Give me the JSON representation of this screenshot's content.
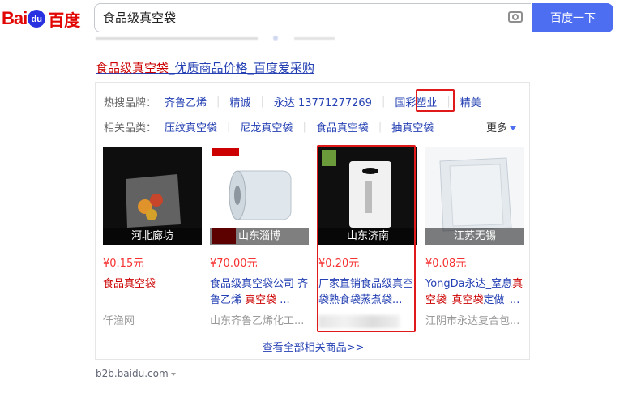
{
  "header": {
    "logo_text": "Bai",
    "logo_paw": "du",
    "logo_cn": "百度",
    "search_value": "食品级真空袋",
    "search_button": "百度一下",
    "icons": {
      "camera": "camera-icon"
    }
  },
  "result": {
    "title_kw": "食品级真空袋",
    "title_rest": "_优质商品价格_百度爱采购"
  },
  "brands": {
    "label": "热搜品牌：",
    "items": [
      "齐鲁乙烯",
      "精诚",
      "永达 13771277269",
      "国彩塑业",
      "精美"
    ]
  },
  "categories": {
    "label": "相关品类：",
    "items": [
      "压纹真空袋",
      "尼龙真空袋",
      "食品真空袋",
      "抽真空袋"
    ],
    "more": "更多"
  },
  "products": [
    {
      "location": "河北廊坊",
      "price": "¥0.15元",
      "name_kw": "食品真空袋",
      "name_rest": "",
      "seller": "仟渔网"
    },
    {
      "location": "山东淄博",
      "price": "¥70.00元",
      "name_pre": "食品级真空袋公司 齐鲁乙烯 ",
      "name_kw": "真空袋",
      "name_rest": " ...",
      "seller": "山东齐鲁乙烯化工..."
    },
    {
      "location": "山东济南",
      "price": "¥0.20元",
      "name_pre": "厂家直销食品级真空袋熟食袋蒸煮袋...",
      "seller": ""
    },
    {
      "location": "江苏无锡",
      "price": "¥0.08元",
      "name_pre": "YongDa永达_窒息",
      "name_kw2": "真空袋",
      "name_mid": "_",
      "name_kw": "真空袋",
      "name_rest": "定做_...",
      "seller": "江阴市永达复合包..."
    }
  ],
  "view_all": "查看全部相关商品>>",
  "footer_url": "b2b.baidu.com",
  "colors": {
    "link": "#2440b3",
    "price": "#f73131",
    "highlight": "#e0191b",
    "brand_blue": "#4e6ef2"
  }
}
